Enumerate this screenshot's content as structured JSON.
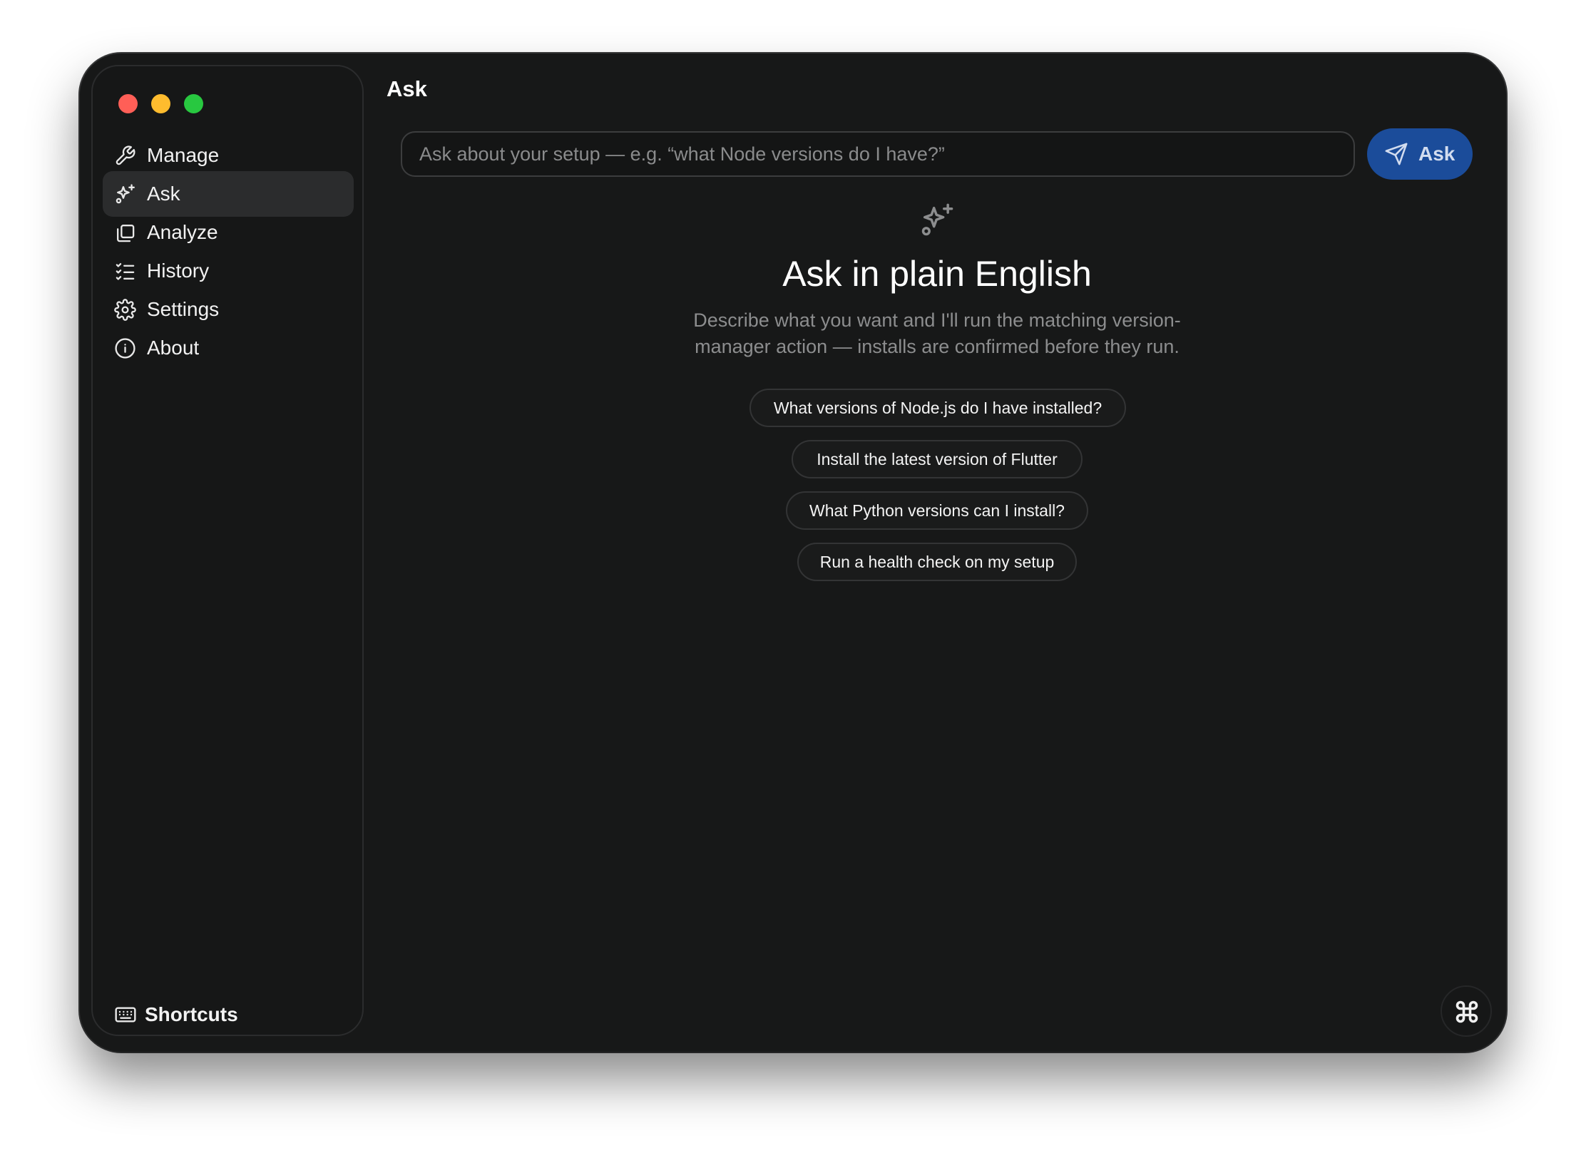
{
  "window": {
    "traffic_lights": [
      "close",
      "minimize",
      "zoom"
    ]
  },
  "sidebar": {
    "items": [
      {
        "label": "Manage",
        "icon": "wrench-icon",
        "active": false
      },
      {
        "label": "Ask",
        "icon": "sparkles-icon",
        "active": true
      },
      {
        "label": "Analyze",
        "icon": "copy-icon",
        "active": false
      },
      {
        "label": "History",
        "icon": "list-checks-icon",
        "active": false
      },
      {
        "label": "Settings",
        "icon": "gear-icon",
        "active": false
      },
      {
        "label": "About",
        "icon": "info-icon",
        "active": false
      }
    ],
    "footer": {
      "label": "Shortcuts",
      "icon": "keyboard-icon"
    }
  },
  "header": {
    "title": "Ask"
  },
  "search": {
    "placeholder": "Ask about your setup — e.g. “what Node versions do I have?”",
    "value": "",
    "button_label": "Ask",
    "button_icon": "send-icon"
  },
  "hero": {
    "icon": "sparkles-icon",
    "title": "Ask in plain English",
    "description": "Describe what you want and I'll run the matching version-manager action — installs are confirmed before they run."
  },
  "suggestions": [
    "What versions of Node.js do I have installed?",
    "Install the latest version of Flutter",
    "What Python versions can I install?",
    "Run a health check on my setup"
  ],
  "corner_button": {
    "icon": "command-icon"
  },
  "colors": {
    "window_bg": "#171818",
    "sidebar_bg": "#161717",
    "active_item_bg": "#2b2c2d",
    "accent": "#1b4c9a",
    "muted_text": "#8c8d8e"
  }
}
